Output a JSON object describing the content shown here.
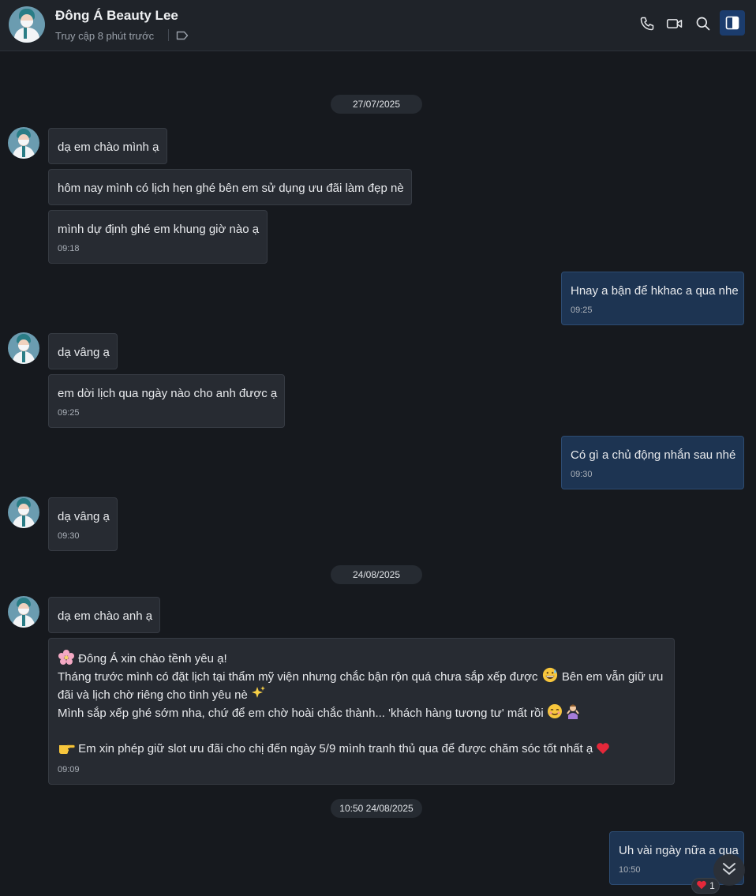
{
  "header": {
    "contact_name": "Đông Á Beauty Lee",
    "status": "Truy cập 8 phút trước",
    "icons": [
      "phone-icon",
      "video-call-icon",
      "search-icon",
      "side-panel-icon",
      "tag-icon"
    ]
  },
  "dates": {
    "d1": "27/07/2025",
    "d2": "24/08/2025",
    "d3": "10:50 24/08/2025"
  },
  "messages": {
    "m1": {
      "text": "dạ em chào mình ạ"
    },
    "m2": {
      "text": "hôm nay mình có lịch hẹn ghé bên em sử dụng ưu đãi làm đẹp nè"
    },
    "m3": {
      "text": "mình dự định ghé em khung giờ nào ạ",
      "time": "09:18"
    },
    "m4": {
      "text": "Hnay a bận để hkhac a qua nhe",
      "time": "09:25"
    },
    "m5": {
      "text": "dạ vâng ạ"
    },
    "m6": {
      "text": "em dời lịch qua ngày nào cho anh được ạ",
      "time": "09:25"
    },
    "m7": {
      "text": "Có gì a chủ động nhắn sau nhé",
      "time": "09:30"
    },
    "m8": {
      "text": "dạ vâng ạ",
      "time": "09:30"
    },
    "m9": {
      "text": "dạ em chào anh ạ"
    },
    "m10": {
      "line1": "Đông Á  xin chào tềnh yêu ạ!",
      "line2": "Tháng trước mình có đặt lịch tại thẩm mỹ viện nhưng chắc bận rộn quá chưa sắp xếp được",
      "line2b": "Bên em vẫn giữ ưu",
      "line3": "đãi và lịch chờ riêng cho tình yêu nè",
      "line4": "Mình sắp xếp ghé sớm nha, chứ để em chờ hoài chắc thành... 'khách hàng tương tư' mất rồi",
      "line6": "Em xin phép giữ slot ưu đãi cho chị đến ngày 5/9 mình tranh thủ qua để được chăm sóc tốt nhất ạ",
      "time": "09:09"
    },
    "m11": {
      "text": "Uh vài ngày nữa a qua",
      "time": "10:50",
      "reaction_count": "1"
    }
  },
  "colors": {
    "background": "#16191e",
    "incoming_bubble": "#272b32",
    "outgoing_bubble": "#1d3452",
    "accent": "#1b3c6d"
  }
}
